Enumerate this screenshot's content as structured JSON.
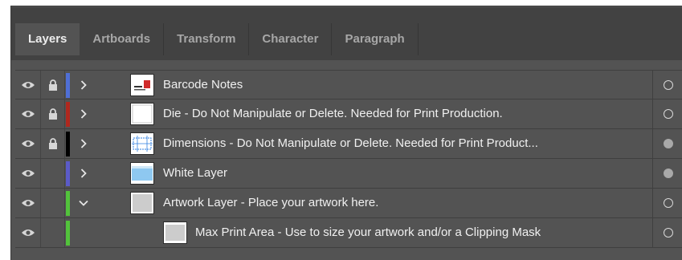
{
  "tabs": [
    {
      "label": "Layers",
      "active": true
    },
    {
      "label": "Artboards",
      "active": false
    },
    {
      "label": "Transform",
      "active": false
    },
    {
      "label": "Character",
      "active": false
    },
    {
      "label": "Paragraph",
      "active": false
    }
  ],
  "layers": [
    {
      "name": "Barcode Notes",
      "visible": true,
      "locked": true,
      "color": "#4f6fd6",
      "expanded": false,
      "target_filled": false,
      "icons": {
        "eye": "eye-icon",
        "lock": "lock-icon"
      }
    },
    {
      "name": "Die - Do Not Manipulate or Delete.  Needed for Print Production.",
      "visible": true,
      "locked": true,
      "color": "#b0281e",
      "expanded": false,
      "target_filled": false
    },
    {
      "name": "Dimensions - Do Not Manipulate or Delete.  Needed for Print Product...",
      "visible": true,
      "locked": true,
      "color": "#000000",
      "expanded": false,
      "target_filled": true
    },
    {
      "name": "White Layer",
      "visible": true,
      "locked": false,
      "color": "#5b5bc8",
      "expanded": false,
      "target_filled": true
    },
    {
      "name": "Artwork Layer - Place your artwork here.",
      "visible": true,
      "locked": false,
      "color": "#52c33b",
      "expanded": true,
      "target_filled": false
    },
    {
      "name": "Max Print Area - Use to size your artwork and/or a Clipping Mask",
      "visible": true,
      "locked": false,
      "color": "#52c33b",
      "sublayer": true,
      "target_filled": false
    }
  ]
}
